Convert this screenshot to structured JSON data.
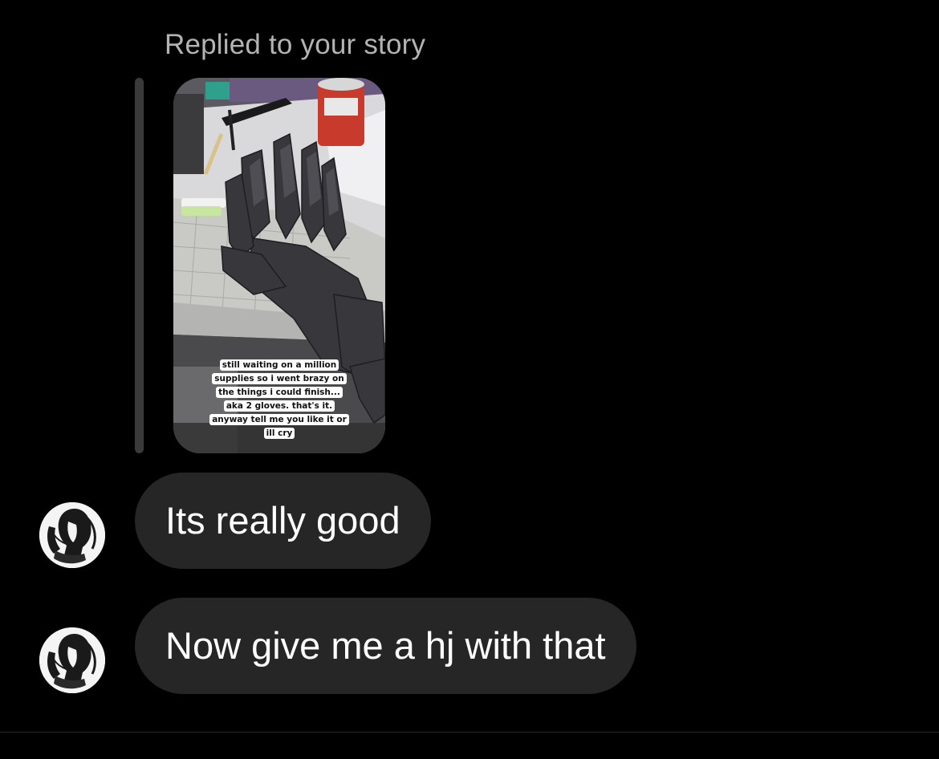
{
  "reply": {
    "label": "Replied to your story"
  },
  "story": {
    "caption_lines": [
      "still waiting on a million",
      "supplies so i went brazy on",
      "the things i could finish...",
      "aka 2 gloves. that's it.",
      "anyway tell me you like it or",
      "ill cry"
    ]
  },
  "messages": [
    {
      "text": "Its really good",
      "avatar_icon": "profile-avatar"
    },
    {
      "text": "Now give me a hj with that",
      "avatar_icon": "profile-avatar"
    }
  ],
  "colors": {
    "background": "#000000",
    "bubble": "#262626",
    "reply_label": "#b3b3b3",
    "quote_bar": "#3a3a3a"
  }
}
